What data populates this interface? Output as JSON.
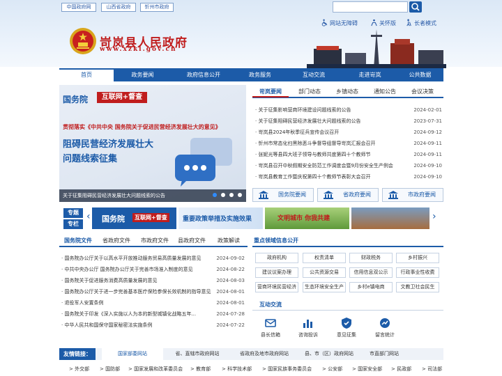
{
  "top_links": [
    "中国政府网",
    "山西省政府",
    "忻州市政府"
  ],
  "accessibility": {
    "barrier_free": "网站无障碍",
    "care": "关怀版",
    "elder": "长者模式"
  },
  "brand": {
    "name": "岢岚县人民政府",
    "domain": "www.xzkl.gov.cn"
  },
  "nav": [
    "首页",
    "政务要闻",
    "政府信息公开",
    "政务服务",
    "互动交流",
    "走进岢岚",
    "公共数据"
  ],
  "banner": {
    "badge_left": "国务院",
    "badge_right": "互联网+督查",
    "headline1": "贯彻落实《中共中央 国务院关于促进民营经济发展壮大的意见》",
    "headline2": "阻碍民营经济发展壮大",
    "headline3": "问题线索征集",
    "caption": "关于征集阻碍民营经济发展壮大问题线索的公告"
  },
  "news": {
    "tabs": [
      "岢岚要闻",
      "部门动态",
      "乡镇动态",
      "通知公告",
      "会议决策"
    ],
    "rows": [
      {
        "title": "关于征集影响营商环境建设问题线索的公告",
        "date": "2024-02-01"
      },
      {
        "title": "关于征集阻碍民营经济发展壮大问题线索的公告",
        "date": "2023-07-31"
      },
      {
        "title": "岢岚县2024年秋季征兵宣传会议召开",
        "date": "2024-09-12"
      },
      {
        "title": "忻州市常态化扫黑除恶斗争督导组督导岢岚汇报会召开",
        "date": "2024-09-11"
      },
      {
        "title": "张妮光等县四大班子领导与教师共度第四十个教师节",
        "date": "2024-09-11"
      },
      {
        "title": "岢岚县召开中秋假期安全防范工作调度会暨9月份安全生产例会",
        "date": "2024-09-10"
      },
      {
        "title": "岢岚县教育工作暨庆祝第四十个教师节表彰大会召开",
        "date": "2024-09-10"
      }
    ]
  },
  "quick": [
    "国务院要闻",
    "省政府要闻",
    "市政府要闻"
  ],
  "special": {
    "label_top": "专题",
    "label_bottom": "专栏",
    "slide1_left": "国务院",
    "slide1_right": "互联网+督查",
    "slide2": "重要政策举措及实施效果",
    "slide3": "文明城市 你我共建"
  },
  "docs": {
    "tabs": [
      "国务院文件",
      "省政府文件",
      "市政府文件",
      "县政府文件",
      "政策解读"
    ],
    "rows": [
      {
        "title": "国务院办公厅关于以高水平开放推动服务贸易高质量发展的意见",
        "date": "2024-09-02"
      },
      {
        "title": "中共中央办公厅 国务院办公厅关于完善市场准入制度的意见",
        "date": "2024-08-22"
      },
      {
        "title": "国务院关于促进服务消费高质量发展的意见",
        "date": "2024-08-03"
      },
      {
        "title": "国务院办公厅关于进一步完善基本医疗保险参保长效机制的指导意见",
        "date": "2024-08-01"
      },
      {
        "title": "退役军人安置条例",
        "date": "2024-08-01"
      },
      {
        "title": "国务院关于印发《深入实施以人为本的新型城镇化战略五年...",
        "date": "2024-07-28"
      },
      {
        "title": "中华人民共和国保守国家秘密法实施条例",
        "date": "2024-07-22"
      }
    ]
  },
  "key_areas": {
    "title": "重点领域信息公开",
    "items": [
      "政府机构",
      "权责清单",
      "财政税务",
      "乡村振兴",
      "建议议案办理",
      "公共资源交易",
      "信用信息双公示",
      "行政事业性收费",
      "营商环境民营经济",
      "生态环境安全生产",
      "乡村e镇电商",
      "文教卫社会民生"
    ]
  },
  "interaction": {
    "title": "互动交流",
    "items": [
      "县长信箱",
      "咨询投诉",
      "意见征集",
      "留言统计"
    ]
  },
  "friend_links": {
    "label": "友情链接：",
    "tabs": [
      "国家部委网站",
      "省、直辖市政府网站",
      "省政府及地市政府网站",
      "县、市（区）政府网站",
      "市直部门网站"
    ],
    "links": [
      "> 外交部",
      "> 国防部",
      "> 国家发展和改革委员会",
      "> 教育部",
      "> 科学技术部",
      "> 国家民族事务委员会",
      "> 公安部",
      "> 国家安全部",
      "> 民政部",
      "> 司法部"
    ]
  },
  "colors": {
    "primary": "#1c5ba8",
    "brand_red": "#c01d1d"
  }
}
